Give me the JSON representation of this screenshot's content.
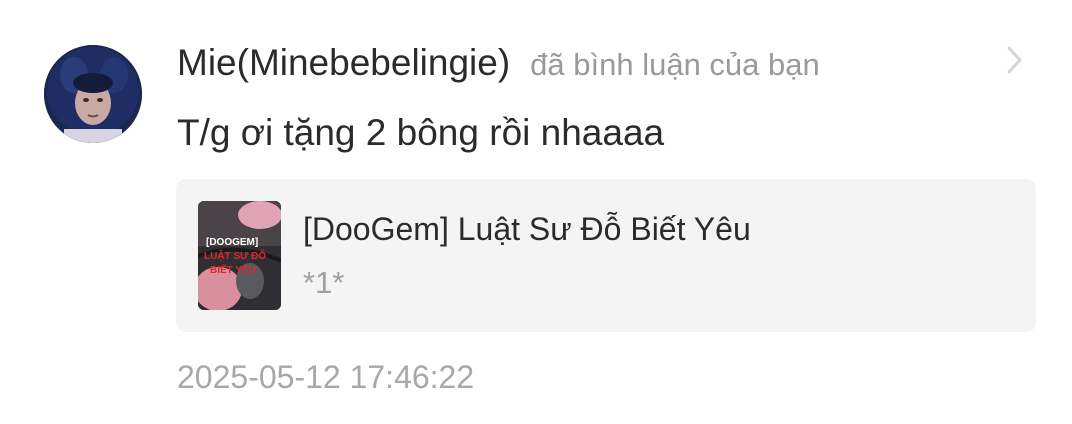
{
  "notification": {
    "avatar_icon": "user-avatar-icon",
    "username": "Mie(Minebebelingie)",
    "action_text": "đã bình luận của bạn",
    "comment": "T/g ơi tặng 2 bông rồi nhaaaa",
    "chevron_icon": "chevron-right-icon",
    "book": {
      "cover_icon": "book-cover-image",
      "cover_text_line1": "[DOOGEM]",
      "cover_text_line2": "LUẬT SƯ ĐỖ",
      "cover_text_line3": "BIẾT YÊU",
      "title": "[DooGem] Luật Sư Đỗ Biết Yêu",
      "chapter": "*1*"
    },
    "timestamp": "2025-05-12 17:46:22"
  },
  "colors": {
    "card_background": "#f4f4f5",
    "primary_text": "#2b2b2b",
    "secondary_text": "#9a9a9a",
    "cover_accent_red": "#e0262c"
  }
}
